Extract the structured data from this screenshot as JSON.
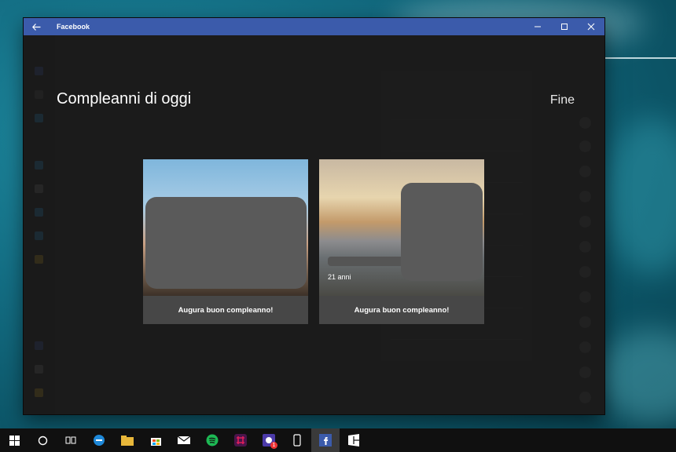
{
  "window": {
    "title": "Facebook"
  },
  "overlay": {
    "title": "Compleanni di oggi",
    "done_label": "Fine"
  },
  "cards": [
    {
      "age_text": "",
      "wish_label": "Augura buon compleanno!"
    },
    {
      "age_text": "21 anni",
      "wish_label": "Augura buon compleanno!"
    }
  ],
  "taskbar": {
    "notification_badge": "1",
    "items": [
      "windows-start-icon",
      "cortana-icon",
      "task-view-icon",
      "edge-icon",
      "file-explorer-icon",
      "store-icon",
      "mail-icon",
      "spotify-icon",
      "slack-icon",
      "chrome-icon",
      "phone-icon",
      "facebook-icon",
      "flipboard-icon"
    ]
  },
  "colors": {
    "titlebar": "#3b5bab",
    "overlay": "#181818",
    "card_button": "#474747",
    "taskbar": "#101010"
  }
}
